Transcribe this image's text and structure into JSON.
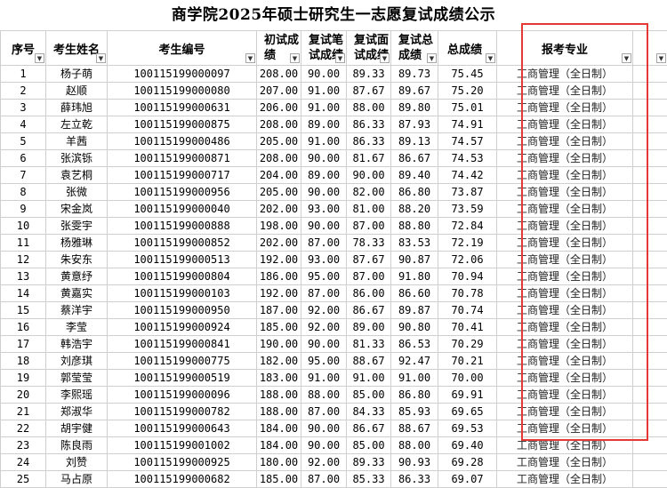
{
  "title": "商学院2025年硕士研究生一志愿复试成绩公示",
  "headers": {
    "idx": "序号",
    "name": "考生姓名",
    "exam_id": "考生编号",
    "initial": [
      "初试成",
      "绩"
    ],
    "written": [
      "复试笔",
      "试成绩"
    ],
    "interview": [
      "复试面",
      "试成绩"
    ],
    "retest_total": [
      "复试总",
      "成绩"
    ],
    "total": "总成绩",
    "major": "报考专业"
  },
  "filter_icon": "dropdown-filter-icon",
  "highlight_color": "#e53935",
  "rows": [
    {
      "idx": "1",
      "name": "杨子萌",
      "id": "100115199000097",
      "initial": "208.00",
      "written": "90.00",
      "interview": "89.33",
      "retest": "89.73",
      "total": "75.45",
      "major": "工商管理（全日制）"
    },
    {
      "idx": "2",
      "name": "赵顺",
      "id": "100115199000080",
      "initial": "207.00",
      "written": "91.00",
      "interview": "87.67",
      "retest": "89.67",
      "total": "75.20",
      "major": "工商管理（全日制）"
    },
    {
      "idx": "3",
      "name": "薛玮旭",
      "id": "100115199000631",
      "initial": "206.00",
      "written": "91.00",
      "interview": "88.00",
      "retest": "89.80",
      "total": "75.01",
      "major": "工商管理（全日制）"
    },
    {
      "idx": "4",
      "name": "左立乾",
      "id": "100115199000875",
      "initial": "208.00",
      "written": "89.00",
      "interview": "86.33",
      "retest": "87.93",
      "total": "74.91",
      "major": "工商管理（全日制）"
    },
    {
      "idx": "5",
      "name": "羊茜",
      "id": "100115199000486",
      "initial": "205.00",
      "written": "91.00",
      "interview": "86.33",
      "retest": "89.13",
      "total": "74.57",
      "major": "工商管理（全日制）"
    },
    {
      "idx": "6",
      "name": "张滨铄",
      "id": "100115199000871",
      "initial": "208.00",
      "written": "90.00",
      "interview": "81.67",
      "retest": "86.67",
      "total": "74.53",
      "major": "工商管理（全日制）"
    },
    {
      "idx": "7",
      "name": "袁艺桐",
      "id": "100115199000717",
      "initial": "204.00",
      "written": "89.00",
      "interview": "90.00",
      "retest": "89.40",
      "total": "74.42",
      "major": "工商管理（全日制）"
    },
    {
      "idx": "8",
      "name": "张微",
      "id": "100115199000956",
      "initial": "205.00",
      "written": "90.00",
      "interview": "82.00",
      "retest": "86.80",
      "total": "73.87",
      "major": "工商管理（全日制）"
    },
    {
      "idx": "9",
      "name": "宋金岚",
      "id": "100115199000040",
      "initial": "202.00",
      "written": "93.00",
      "interview": "81.00",
      "retest": "88.20",
      "total": "73.59",
      "major": "工商管理（全日制）"
    },
    {
      "idx": "10",
      "name": "张雯宇",
      "id": "100115199000888",
      "initial": "198.00",
      "written": "90.00",
      "interview": "87.00",
      "retest": "88.80",
      "total": "72.84",
      "major": "工商管理（全日制）"
    },
    {
      "idx": "11",
      "name": "杨雅琳",
      "id": "100115199000852",
      "initial": "202.00",
      "written": "87.00",
      "interview": "78.33",
      "retest": "83.53",
      "total": "72.19",
      "major": "工商管理（全日制）"
    },
    {
      "idx": "12",
      "name": "朱安东",
      "id": "100115199000513",
      "initial": "192.00",
      "written": "93.00",
      "interview": "87.67",
      "retest": "90.87",
      "total": "72.06",
      "major": "工商管理（全日制）"
    },
    {
      "idx": "13",
      "name": "黄意纾",
      "id": "100115199000804",
      "initial": "186.00",
      "written": "95.00",
      "interview": "87.00",
      "retest": "91.80",
      "total": "70.94",
      "major": "工商管理（全日制）"
    },
    {
      "idx": "14",
      "name": "黄嘉实",
      "id": "100115199000103",
      "initial": "192.00",
      "written": "87.00",
      "interview": "86.00",
      "retest": "86.60",
      "total": "70.78",
      "major": "工商管理（全日制）"
    },
    {
      "idx": "15",
      "name": "蔡洋宇",
      "id": "100115199000950",
      "initial": "187.00",
      "written": "92.00",
      "interview": "86.67",
      "retest": "89.87",
      "total": "70.74",
      "major": "工商管理（全日制）"
    },
    {
      "idx": "16",
      "name": "李莹",
      "id": "100115199000924",
      "initial": "185.00",
      "written": "92.00",
      "interview": "89.00",
      "retest": "90.80",
      "total": "70.41",
      "major": "工商管理（全日制）"
    },
    {
      "idx": "17",
      "name": "韩浩宇",
      "id": "100115199000841",
      "initial": "190.00",
      "written": "90.00",
      "interview": "81.33",
      "retest": "86.53",
      "total": "70.29",
      "major": "工商管理（全日制）"
    },
    {
      "idx": "18",
      "name": "刘彦琪",
      "id": "100115199000775",
      "initial": "182.00",
      "written": "95.00",
      "interview": "88.67",
      "retest": "92.47",
      "total": "70.21",
      "major": "工商管理（全日制）"
    },
    {
      "idx": "19",
      "name": "郭莹莹",
      "id": "100115199000519",
      "initial": "183.00",
      "written": "91.00",
      "interview": "91.00",
      "retest": "91.00",
      "total": "70.00",
      "major": "工商管理（全日制）"
    },
    {
      "idx": "20",
      "name": "李熙瑶",
      "id": "100115199000096",
      "initial": "188.00",
      "written": "88.00",
      "interview": "85.00",
      "retest": "86.80",
      "total": "69.91",
      "major": "工商管理（全日制）"
    },
    {
      "idx": "21",
      "name": "郑淑华",
      "id": "100115199000782",
      "initial": "188.00",
      "written": "87.00",
      "interview": "84.33",
      "retest": "85.93",
      "total": "69.65",
      "major": "工商管理（全日制）"
    },
    {
      "idx": "22",
      "name": "胡宇健",
      "id": "100115199000643",
      "initial": "184.00",
      "written": "90.00",
      "interview": "86.67",
      "retest": "88.67",
      "total": "69.53",
      "major": "工商管理（全日制）"
    },
    {
      "idx": "23",
      "name": "陈良雨",
      "id": "100115199001002",
      "initial": "184.00",
      "written": "90.00",
      "interview": "85.00",
      "retest": "88.00",
      "total": "69.40",
      "major": "工商管理（全日制）"
    },
    {
      "idx": "24",
      "name": "刘赞",
      "id": "100115199000925",
      "initial": "180.00",
      "written": "92.00",
      "interview": "89.33",
      "retest": "90.93",
      "total": "69.28",
      "major": "工商管理（全日制）"
    },
    {
      "idx": "25",
      "name": "马占原",
      "id": "100115199000682",
      "initial": "185.00",
      "written": "87.00",
      "interview": "85.33",
      "retest": "86.33",
      "total": "69.07",
      "major": "工商管理（全日制）"
    }
  ]
}
